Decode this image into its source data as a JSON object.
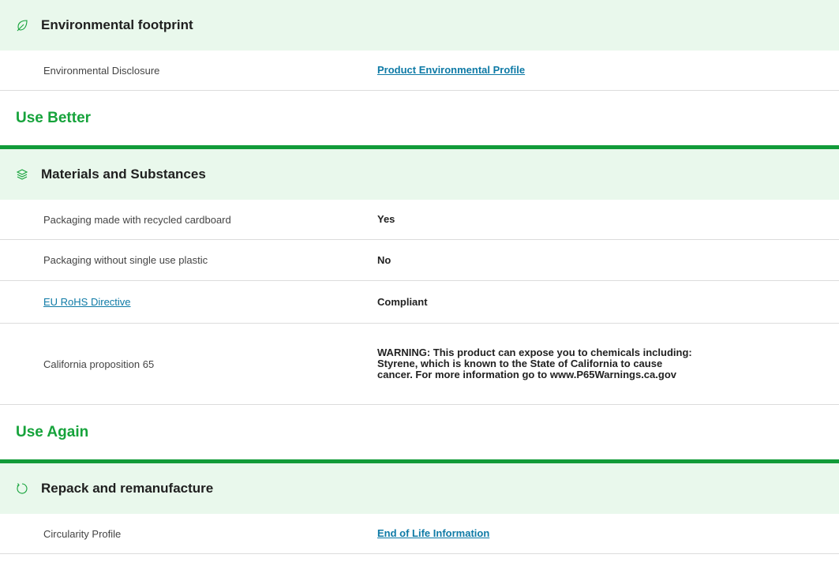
{
  "sections": {
    "footprint": {
      "title": "Environmental footprint",
      "icon": "leaf-icon",
      "rows": [
        {
          "label": "Environmental Disclosure",
          "value": "Product Environmental Profile"
        }
      ]
    },
    "use_better": {
      "heading": "Use Better"
    },
    "materials": {
      "title": "Materials and Substances",
      "icon": "layers-icon",
      "rows": [
        {
          "label": "Packaging made with recycled cardboard",
          "value": "Yes"
        },
        {
          "label": "Packaging without single use plastic",
          "value": "No"
        },
        {
          "label": "EU RoHS Directive",
          "value": "Compliant"
        },
        {
          "label": "California proposition 65",
          "value": "WARNING: This product can expose you to chemicals including: Styrene, which is known to the State of California to cause cancer. For more information go to www.P65Warnings.ca.gov"
        }
      ]
    },
    "use_again": {
      "heading": "Use Again"
    },
    "repack": {
      "title": "Repack and remanufacture",
      "icon": "refresh-icon",
      "rows": [
        {
          "label": "Circularity Profile",
          "value": "End of Life Information"
        }
      ]
    }
  },
  "colors": {
    "header_bg": "#e9f8ec",
    "accent_green": "#16a33b",
    "divider_green": "#119b39",
    "link_blue": "#0e7aa6",
    "row_border": "#dcdcdc"
  }
}
